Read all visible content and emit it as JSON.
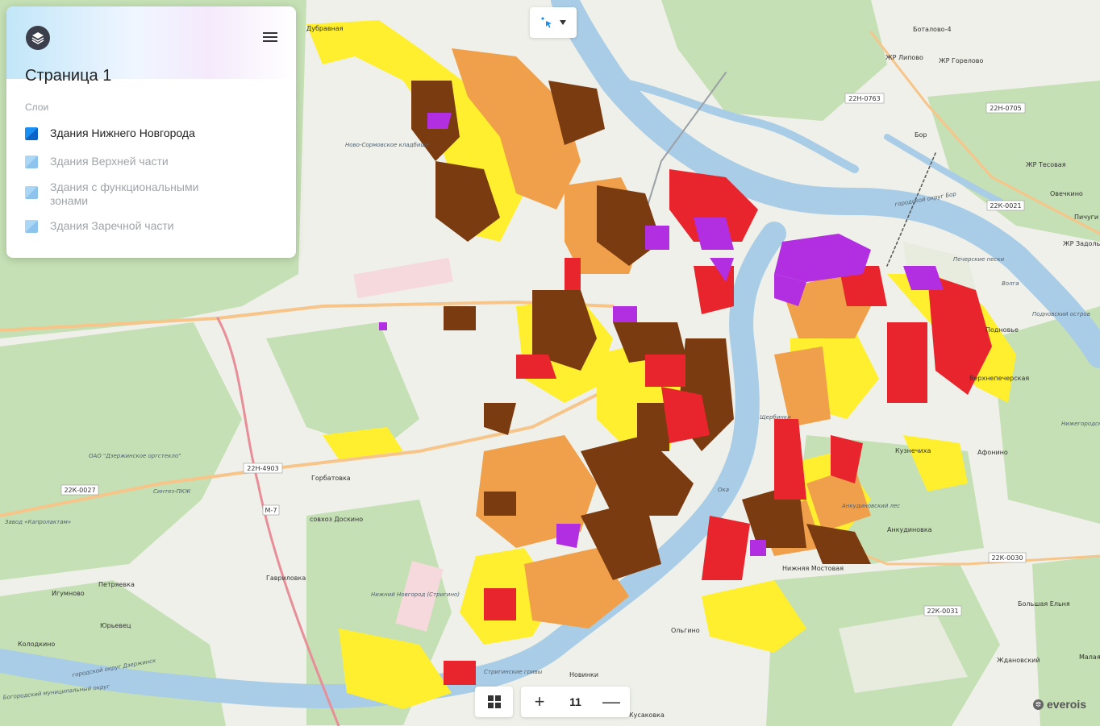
{
  "panel": {
    "title": "Страница 1",
    "layers_label": "Слои",
    "layers": [
      {
        "label": "Здания Нижнего Новгорода",
        "active": true
      },
      {
        "label": "Здания Верхней части",
        "active": false
      },
      {
        "label": "Здания с функциональными зонами",
        "active": false
      },
      {
        "label": "Здания Заречной части",
        "active": false
      }
    ]
  },
  "zoom": {
    "level": "11",
    "plus": "+",
    "minus": "—"
  },
  "brand": {
    "name": "everois"
  },
  "colors": {
    "water": "#a9cde6",
    "forest": "#c5e0b4",
    "field": "#eef0e9",
    "building_yellow": "#ffef2e",
    "building_orange": "#f0a04a",
    "building_red": "#e8242c",
    "building_brown": "#7a3b10",
    "building_purple": "#b12fe0"
  },
  "map_labels": {
    "durenevo": "Дубравная",
    "botalovo": "Боталово-4",
    "zhr_lipovo": "ЖР Липово",
    "zhr_gorelovo": "ЖР Горелово",
    "bor": "Бор",
    "zhr_tesovaya": "ЖР Тесовая",
    "ovechkino": "Овечкино",
    "pichugi": "Пичуги",
    "zhr_zadolye": "ЖР Задолье",
    "pecherskie": "Печерские пески",
    "volga": "Волга",
    "podnovsky": "Подновский остров",
    "kladbische": "Ново-Сормовское кладбище",
    "ozk": "ОАО \"Дзержинское оргстекло\"",
    "sintez": "Синтез-ПКЖ",
    "zavod": "Завод «Капролактам»",
    "gorbatovka": "Горбатовка",
    "sovkhoz": "совхоз Доскино",
    "gavrilovka": "Гавриловка",
    "patrevka": "Петряевка",
    "igumnovo": "Игумново",
    "yurevets": "Юрьевец",
    "kolodkino": "Колодкино",
    "airport": "Нижний Новгород (Стригино)",
    "oka": "Ока",
    "shevrik": "Щербинки",
    "novaya": "Новинки",
    "kusakovka": "Кусаковка",
    "olgino": "Ольгино",
    "nizhnyaya": "Нижняя Мостовая",
    "ankudinovka": "Анкудиновка",
    "ankudinovsky": "Анкудиновский лес",
    "afonino": "Афонино",
    "nizhegorodskaya": "Нижегородская станция аэрации",
    "bolshaya": "Большая Ельня",
    "zhdanovsky": "Ждановский",
    "malaya": "Малая",
    "strigino_grivy": "Стригинские гривы",
    "kstovo_okrug": "городской округ Бор",
    "dzerzhinsk_okrug": "городской округ Дзержинск",
    "bogorodsk": "Богородский муниципальный округ",
    "nevskaya": "Новинки",
    "podnovye": "Подновье",
    "vyezdnoe": "Верхнепечерская",
    "alexandrovka": "Кузнечиха"
  },
  "road_shields": {
    "r1": "22Н-0763",
    "r2": "22Н-0705",
    "r3": "22К-0021",
    "r4": "22Н-4903",
    "r5": "22К-0027",
    "r6": "М-7",
    "r7": "22К-0030",
    "r8": "22К-0031"
  }
}
